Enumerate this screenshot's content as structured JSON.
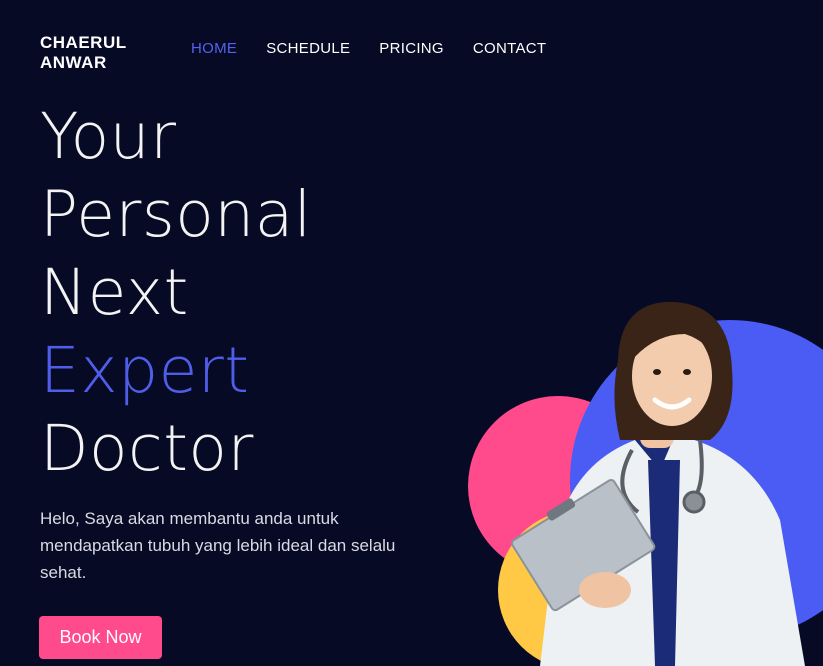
{
  "brand": {
    "line1": "CHAERUL",
    "line2": "ANWAR"
  },
  "nav": [
    {
      "label": "HOME",
      "active": true
    },
    {
      "label": "SCHEDULE",
      "active": false
    },
    {
      "label": "PRICING",
      "active": false
    },
    {
      "label": "CONTACT",
      "active": false
    }
  ],
  "hero": {
    "line1": "Your",
    "line2": "Personal",
    "line3": "Next",
    "line4": "Expert",
    "line5": "Doctor"
  },
  "description": "Helo, Saya akan membantu anda untuk mendapatkan tubuh yang lebih ideal dan selalu sehat.",
  "cta": {
    "label": "Book Now"
  },
  "colors": {
    "background": "#060a25",
    "accent": "#4f5ee8",
    "pink": "#ff4a8c",
    "blob_blue": "#4a5cf4",
    "blob_pink": "#ff4a8c",
    "blob_yellow": "#ffc845"
  }
}
